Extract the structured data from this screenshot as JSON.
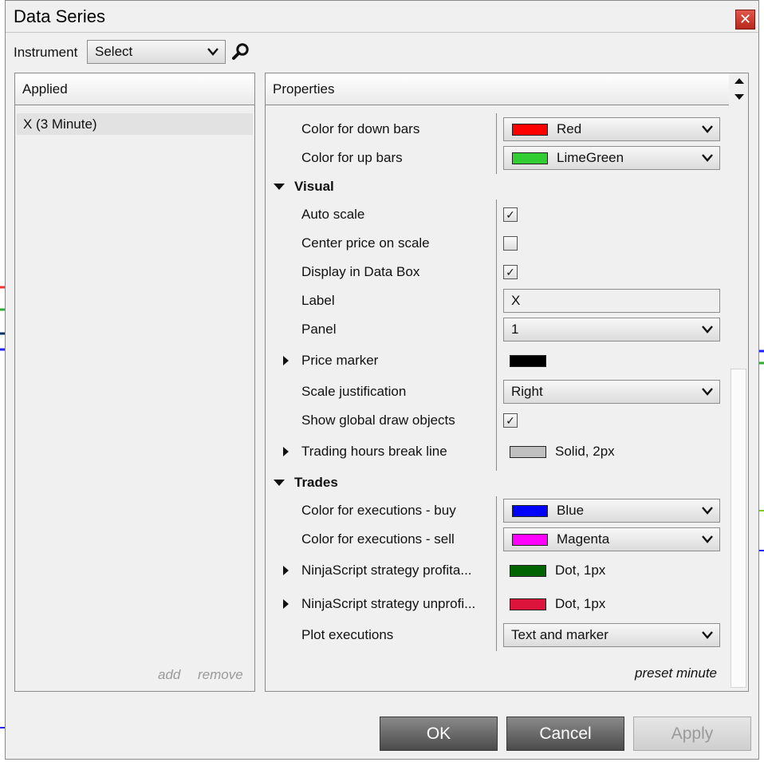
{
  "dialog": {
    "title": "Data Series",
    "close_glyph": "✕"
  },
  "instrument": {
    "label": "Instrument",
    "value": "Select"
  },
  "applied": {
    "header": "Applied",
    "items": [
      "X (3 Minute)"
    ],
    "add_label": "add",
    "remove_label": "remove"
  },
  "properties": {
    "header": "Properties",
    "rows": {
      "down_bars": {
        "name": "Color for down bars",
        "value": "Red",
        "color": "#ff0000"
      },
      "up_bars": {
        "name": "Color for up bars",
        "value": "LimeGreen",
        "color": "#32cd32"
      },
      "visual_category": "Visual",
      "auto_scale": {
        "name": "Auto scale",
        "checked": true
      },
      "center_price": {
        "name": "Center price on scale",
        "checked": false
      },
      "data_box": {
        "name": "Display in Data Box",
        "checked": true
      },
      "label": {
        "name": "Label",
        "value": "X"
      },
      "panel": {
        "name": "Panel",
        "value": "1"
      },
      "price_marker": {
        "name": "Price marker",
        "color": "#000000"
      },
      "scale_just": {
        "name": "Scale justification",
        "value": "Right"
      },
      "global_draw": {
        "name": "Show global draw objects",
        "checked": true
      },
      "break_line": {
        "name": "Trading hours break line",
        "value": "Solid, 2px",
        "color": "#c0c0c0"
      },
      "trades_category": "Trades",
      "exec_buy": {
        "name": "Color for executions - buy",
        "value": "Blue",
        "color": "#0000ff"
      },
      "exec_sell": {
        "name": "Color for executions - sell",
        "value": "Magenta",
        "color": "#ff00ff"
      },
      "profitable": {
        "name": "NinjaScript strategy profita...",
        "value": "Dot, 1px",
        "color": "#006400"
      },
      "unprofitable": {
        "name": "NinjaScript strategy unprofi...",
        "value": "Dot, 1px",
        "color": "#dc143c"
      },
      "plot_exec": {
        "name": "Plot executions",
        "value": "Text and marker"
      }
    },
    "preset": "preset minute"
  },
  "buttons": {
    "ok": "OK",
    "cancel": "Cancel",
    "apply": "Apply"
  },
  "icons": {
    "search": "search-icon",
    "check": "✓"
  }
}
